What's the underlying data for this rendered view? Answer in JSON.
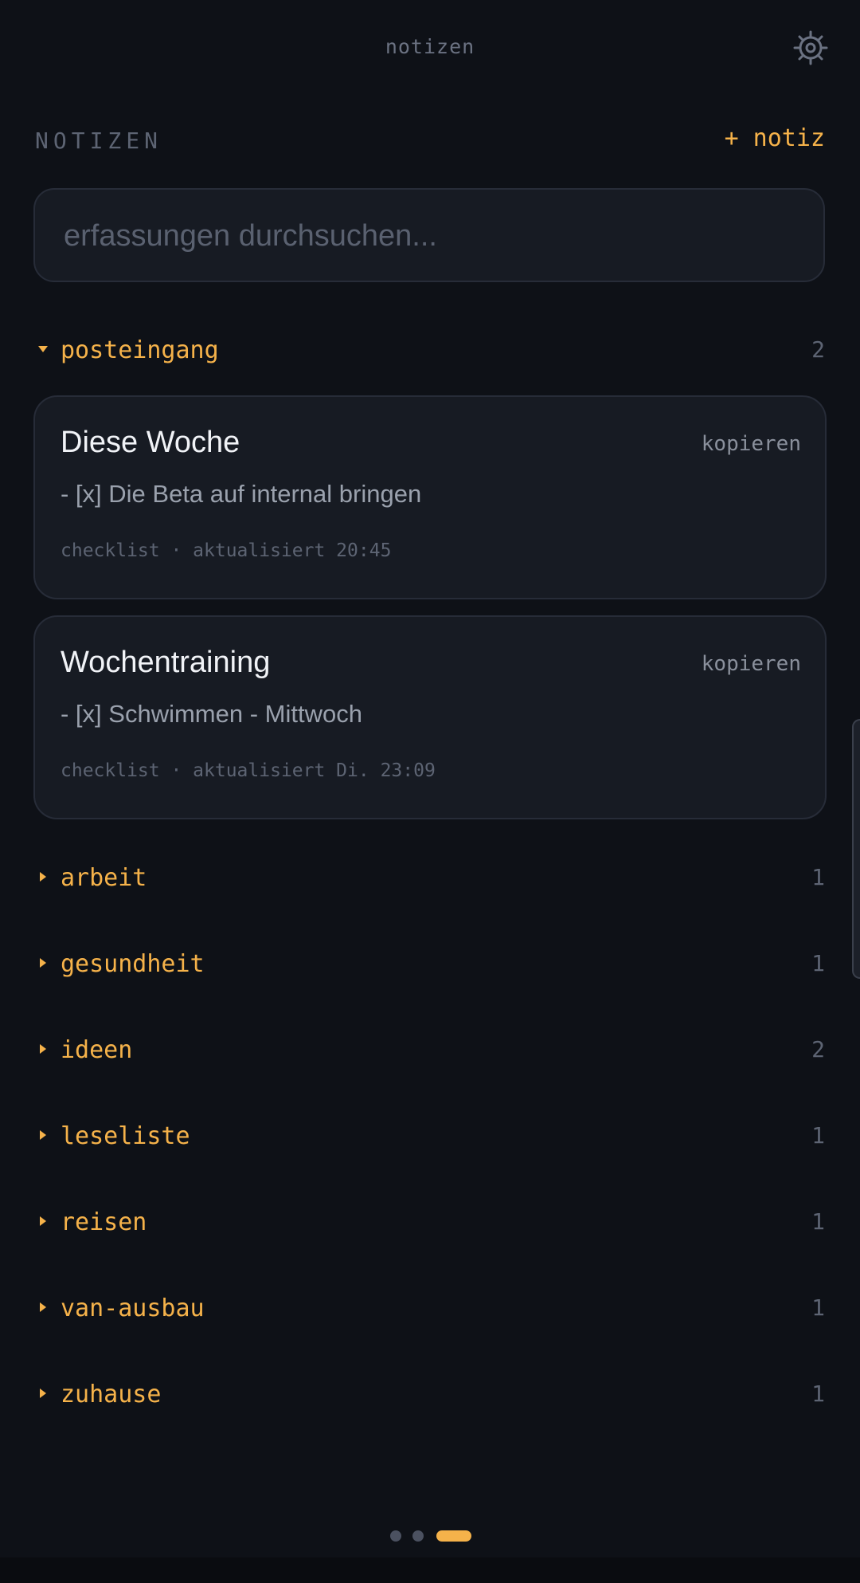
{
  "header": {
    "app_title": "notizen",
    "settings_icon": "gear-icon"
  },
  "section": {
    "title": "NOTIZEN",
    "add_label": "+ notiz"
  },
  "search": {
    "placeholder": "erfassungen durchsuchen...",
    "value": ""
  },
  "groups": [
    {
      "name": "posteingang",
      "count": "2",
      "expanded": true,
      "notes": [
        {
          "title": "Diese Woche",
          "preview": "- [x] Die Beta auf internal bringen",
          "meta": "checklist · aktualisiert 20:45",
          "copy_label": "kopieren"
        },
        {
          "title": "Wochentraining",
          "preview": "- [x] Schwimmen - Mittwoch",
          "meta": "checklist · aktualisiert Di. 23:09",
          "copy_label": "kopieren"
        }
      ]
    },
    {
      "name": "arbeit",
      "count": "1",
      "expanded": false
    },
    {
      "name": "gesundheit",
      "count": "1",
      "expanded": false
    },
    {
      "name": "ideen",
      "count": "2",
      "expanded": false
    },
    {
      "name": "leseliste",
      "count": "1",
      "expanded": false
    },
    {
      "name": "reisen",
      "count": "1",
      "expanded": false
    },
    {
      "name": "van-ausbau",
      "count": "1",
      "expanded": false
    },
    {
      "name": "zuhause",
      "count": "1",
      "expanded": false
    }
  ],
  "pager": {
    "pages": 3,
    "active_index": 2
  },
  "colors": {
    "background": "#0e1117",
    "accent": "#f5b24a",
    "card": "#171b23",
    "muted": "#5d6473"
  }
}
